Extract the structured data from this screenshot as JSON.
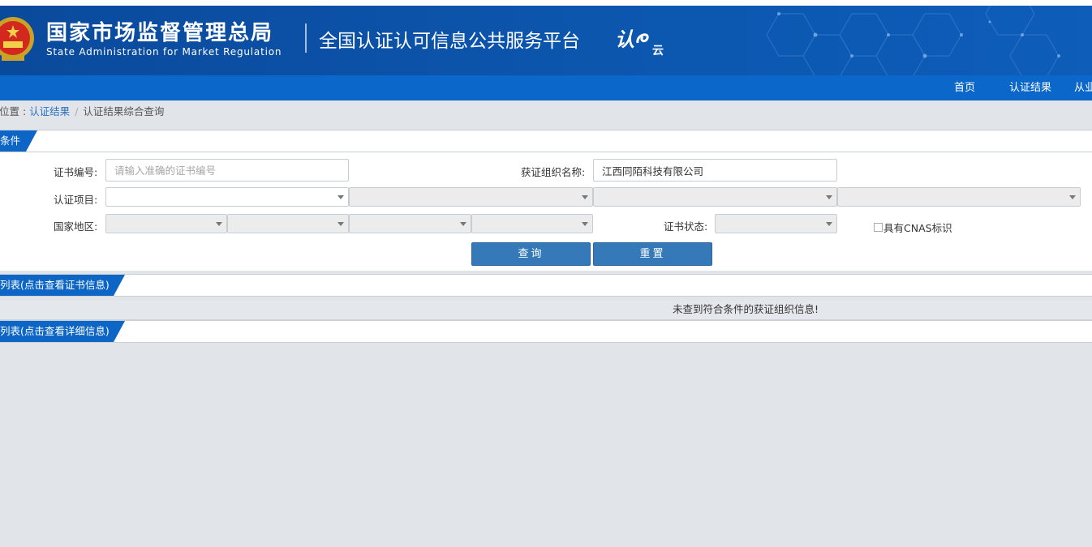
{
  "header": {
    "agency_cn": "国家市场监督管理总局",
    "agency_en": "State Administration  for  Market Regulation",
    "platform_title": "全国认证认可信息公共服务平台",
    "cloud_logo_main": "认",
    "cloud_logo_sub": "云",
    "emblem_icon": "national-emblem-icon"
  },
  "nav": {
    "items": [
      {
        "label": "首页"
      },
      {
        "label": "认证结果"
      },
      {
        "label": "从业"
      }
    ]
  },
  "breadcrumb": {
    "prefix": "位置 : ",
    "level1": "认证结果",
    "separator": "/",
    "current": "认证结果综合查询"
  },
  "search": {
    "section_title": "条件",
    "cert_no_label": "证书编号:",
    "cert_no_placeholder": "请输入准确的证书编号",
    "cert_no_value": "",
    "org_name_label": "获证组织名称:",
    "org_name_value": "江西同陌科技有限公司",
    "cert_project_label": "认证项目:",
    "region_label": "国家地区:",
    "status_label": "证书状态:",
    "cnas_label": "具有CNAS标识",
    "query_button": "查询",
    "reset_button": "重置"
  },
  "results": {
    "org_list_title": "列表(点击查看证书信息)",
    "empty_message": "未查到符合条件的获证组织信息!",
    "detail_list_title": "列表(点击查看详细信息)"
  },
  "colors": {
    "banner_blue": "#0c56ae",
    "nav_blue": "#0b67c9",
    "button_blue": "#3679b8",
    "page_bg": "#e1e5ea"
  }
}
